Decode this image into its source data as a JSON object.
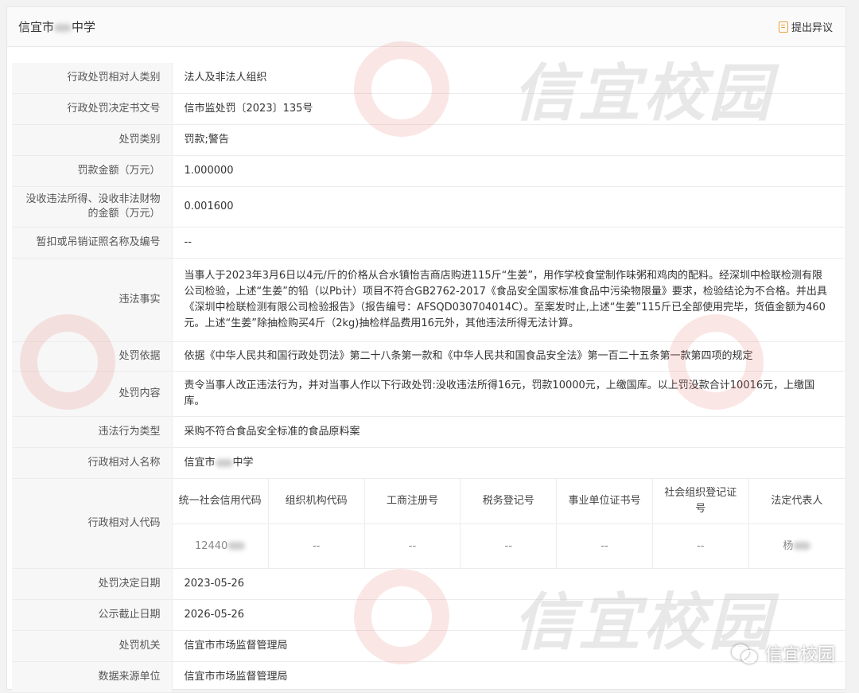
{
  "header": {
    "title": "信宜市",
    "title_suffix": "中学",
    "objection_label": "提出异议"
  },
  "rows": {
    "party_type": {
      "label": "行政处罚相对人类别",
      "value": "法人及非法人组织"
    },
    "decision_no": {
      "label": "行政处罚决定书文号",
      "value": "信市监处罚〔2023〕135号"
    },
    "penalty_type": {
      "label": "处罚类别",
      "value": "罚款;警告"
    },
    "fine_amount": {
      "label": "罚款金额（万元）",
      "value": "1.000000"
    },
    "confiscated_amount": {
      "label": "没收违法所得、没收非法财物的金额（万元）",
      "value": "0.001600"
    },
    "license": {
      "label": "暂扣或吊销证照名称及编号",
      "value": "--"
    },
    "facts": {
      "label": "违法事实",
      "value": "当事人于2023年3月6日以4元/斤的价格从合水镇怡吉商店购进115斤“生姜”，用作学校食堂制作味粥和鸡肉的配料。经深圳中检联检测有限公司检验，上述“生姜”的铅（以Pb计）项目不符合GB2762-2017《食品安全国家标准食品中污染物限量》要求，检验结论为不合格。并出具《深圳中检联检测有限公司检验报告》（报告编号：AFSQD030704014C）。至案发时止,上述“生姜”115斤已全部使用完毕，货值金额为460元。上述“生姜”除抽检购买4斤（2kg)抽检样品费用16元外，其他违法所得无法计算。"
    },
    "basis": {
      "label": "处罚依据",
      "value": "依据《中华人民共和国行政处罚法》第二十八条第一款和《中华人民共和国食品安全法》第一百二十五条第一款第四项的规定"
    },
    "content": {
      "label": "处罚内容",
      "value": "责令当事人改正违法行为，并对当事人作以下行政处罚:没收违法所得16元，罚款10000元，上缴国库。以上罚没款合计10016元，上缴国库。"
    },
    "violation_type": {
      "label": "违法行为类型",
      "value": "采购不符合食品安全标准的食品原料案"
    },
    "party_name": {
      "label": "行政相对人名称",
      "value": "信宜市",
      "value_suffix": "中学"
    },
    "party_code": {
      "label": "行政相对人代码",
      "columns": [
        "统一社会信用代码",
        "组织机构代码",
        "工商注册号",
        "税务登记号",
        "事业单位证书号",
        "社会组织登记证号",
        "法定代表人"
      ],
      "values": [
        "12440",
        "--",
        "--",
        "--",
        "--",
        "--",
        "杨"
      ]
    },
    "decision_date": {
      "label": "处罚决定日期",
      "value": "2023-05-26"
    },
    "deadline": {
      "label": "公示截止日期",
      "value": "2026-05-26"
    },
    "authority": {
      "label": "处罚机关",
      "value": "信宜市市场监督管理局"
    },
    "source": {
      "label": "数据来源单位",
      "value": "信宜市市场监督管理局"
    }
  },
  "watermark": {
    "text": "信宜校园",
    "wechat_label": "信宜校园"
  }
}
